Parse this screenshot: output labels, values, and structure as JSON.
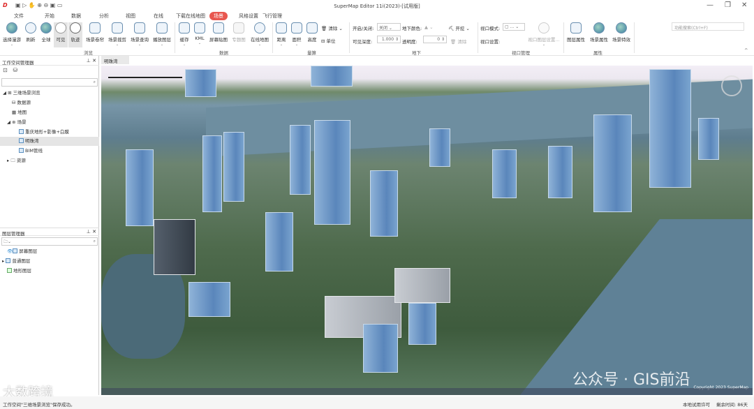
{
  "title": "SuperMap Editor 11i(2023)-[试用版]",
  "search_placeholder": "功能搜索(Ctrl+F)",
  "tabs": [
    "文件",
    "开始",
    "数据",
    "分析",
    "视图",
    "在线",
    "下载在线地图",
    "场景",
    "风格设置",
    "飞行管理"
  ],
  "ribbon": {
    "browse": [
      "选择漫游",
      "刷新",
      "全球",
      "可见",
      "轨迹",
      "场景卷帘",
      "场景裁剪",
      "场景查询",
      "播放图层"
    ],
    "data": [
      "缓存",
      "KML",
      "屏幕贴图",
      "专题图",
      "在线地图"
    ],
    "measure": [
      "距离",
      "面积",
      "高度"
    ],
    "measure_small": [
      "清除",
      "单位"
    ],
    "underground": {
      "onoff_label": "开启/关闭:",
      "onoff_value": "关闭",
      "color_label": "地下颜色:",
      "dig": "开挖",
      "depth_label": "可见深度:",
      "depth_value": "1.000",
      "opacity_label": "透明度:",
      "opacity_value": "0",
      "clear": "清除"
    },
    "viewport": {
      "mode_label": "视口模式:",
      "mode_value": "...",
      "settings_label": "视口设置:",
      "layer_settings": "视口图层设置..."
    },
    "props": [
      "图层属性",
      "场景属性",
      "场景特效"
    ],
    "groups": [
      "浏览",
      "数据",
      "量算",
      "地下",
      "视口管理",
      "属性"
    ]
  },
  "workspace": {
    "title": "工作空间管理器",
    "items": [
      "三维场景浏览",
      "数据源",
      "地图",
      "场景",
      "重庆地形+影像+白膜",
      "明珠湾",
      "BIM管线",
      "资源"
    ]
  },
  "layers": {
    "title": "图层管理器",
    "items": [
      "屏幕图层",
      "普通图层",
      "地形图层"
    ]
  },
  "map_tab": "明珠湾",
  "map": {
    "copyright": "Copyright 2023 SuperMap",
    "watermark": "公众号 · GIS前沿",
    "watermark2": "大数跨境"
  },
  "status": {
    "message": "工作空间\"三维场景浏览\"保存成功。",
    "license": "本地试用许可",
    "remaining": "剩余时间: 86天"
  }
}
